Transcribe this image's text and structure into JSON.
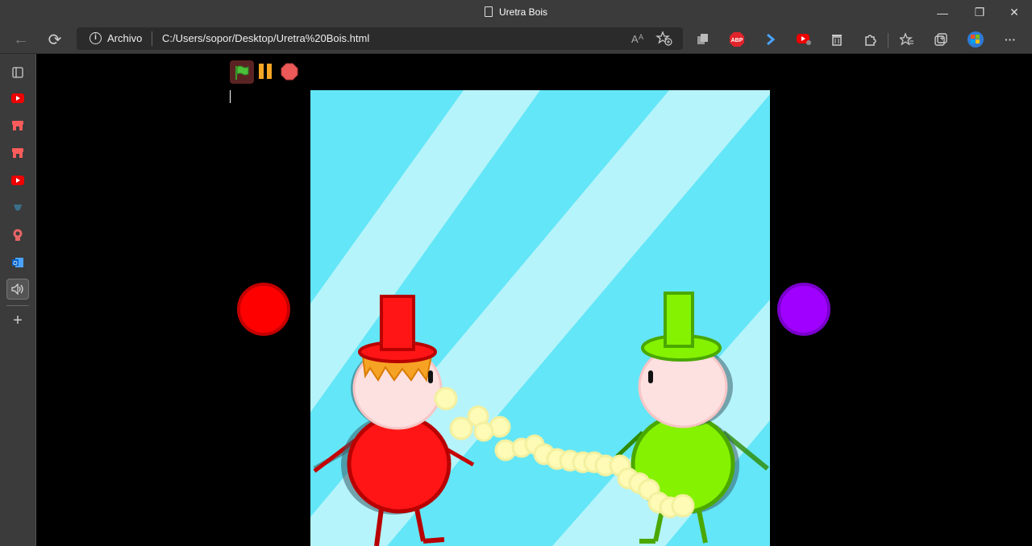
{
  "window": {
    "title": "Uretra Bois",
    "minimize": "—",
    "restore": "❐",
    "close": "✕"
  },
  "toolbar": {
    "back_icon": "←",
    "reload_icon": "⟳",
    "site_label": "Archivo",
    "url": "C:/Users/sopor/Desktop/Uretra%20Bois.html",
    "more_icon": "···",
    "abp_label": "ABP"
  },
  "sidebar": {
    "add_icon": "+"
  },
  "game": {
    "controls": [
      "green-flag",
      "pause",
      "stop"
    ],
    "stage_colors": {
      "background": "#63e6f7",
      "stripe": "#b5f4fb"
    },
    "players": [
      {
        "color": "#ff0000",
        "hat": "red-top-hat",
        "hair": "orange"
      },
      {
        "color": "#84f200",
        "hat": "green-top-hat"
      }
    ],
    "side_buttons": [
      {
        "color": "#ff0000"
      },
      {
        "color": "#a000ff"
      }
    ]
  }
}
